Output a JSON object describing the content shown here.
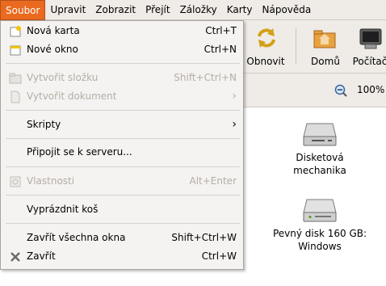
{
  "menubar": {
    "items": [
      "Soubor",
      "Upravit",
      "Zobrazit",
      "Přejít",
      "Záložky",
      "Karty",
      "Nápověda"
    ]
  },
  "toolbar": {
    "reload_label": "Obnovit",
    "home_label": "Domů",
    "computer_label": "Počítač"
  },
  "zoom": {
    "value": "100%"
  },
  "desktop": {
    "floppy_line1": "Disketová",
    "floppy_line2": "mechanika",
    "disk_line1": "Pevný disk 160 GB:",
    "disk_line2": "Windows"
  },
  "menu": {
    "new_tab": {
      "label": "Nová karta",
      "accel": "Ctrl+T"
    },
    "new_window": {
      "label": "Nové okno",
      "accel": "Ctrl+N"
    },
    "new_folder": {
      "label": "Vytvořit složku",
      "accel": "Shift+Ctrl+N"
    },
    "new_document": {
      "label": "Vytvořit dokument"
    },
    "scripts": {
      "label": "Skripty"
    },
    "connect_server": {
      "label": "Připojit se k serveru..."
    },
    "properties": {
      "label": "Vlastnosti",
      "accel": "Alt+Enter"
    },
    "empty_trash": {
      "label": "Vyprázdnit koš"
    },
    "close_all": {
      "label": "Zavřít všechna okna",
      "accel": "Shift+Ctrl+W"
    },
    "close": {
      "label": "Zavřít",
      "accel": "Ctrl+W"
    }
  },
  "colors": {
    "menu_highlight": "#ea6a1f",
    "disabled_text": "#b3ada6"
  }
}
